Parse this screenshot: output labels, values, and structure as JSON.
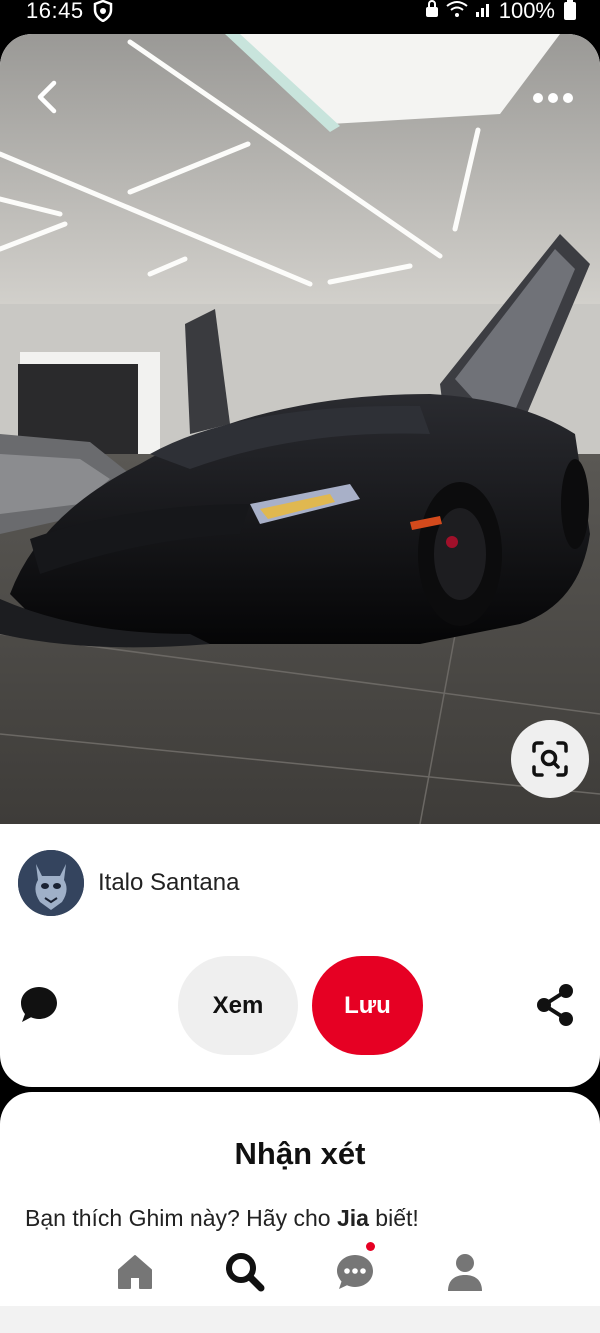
{
  "status_bar": {
    "time": "16:45",
    "battery": "100%",
    "icons": [
      "shield-icon",
      "lock-icon",
      "wifi-icon",
      "signal-icon",
      "battery-icon"
    ]
  },
  "pin": {
    "image": "black-supercar-showroom-photo",
    "creator_name": "Italo Santana",
    "view_label": "Xem",
    "save_label": "Lưu"
  },
  "comments": {
    "title": "Nhận xét",
    "prompt_prefix": "Bạn thích Ghim này? Hãy cho ",
    "prompt_name": "Jia",
    "prompt_suffix": " biết!"
  },
  "nav": {
    "items": [
      "home-icon",
      "search-icon",
      "chat-icon",
      "profile-icon"
    ],
    "active": "search-icon"
  },
  "colors": {
    "accent": "#e60023",
    "button_gray": "#efefef",
    "icon_dark": "#111111",
    "icon_gray": "#767676"
  }
}
